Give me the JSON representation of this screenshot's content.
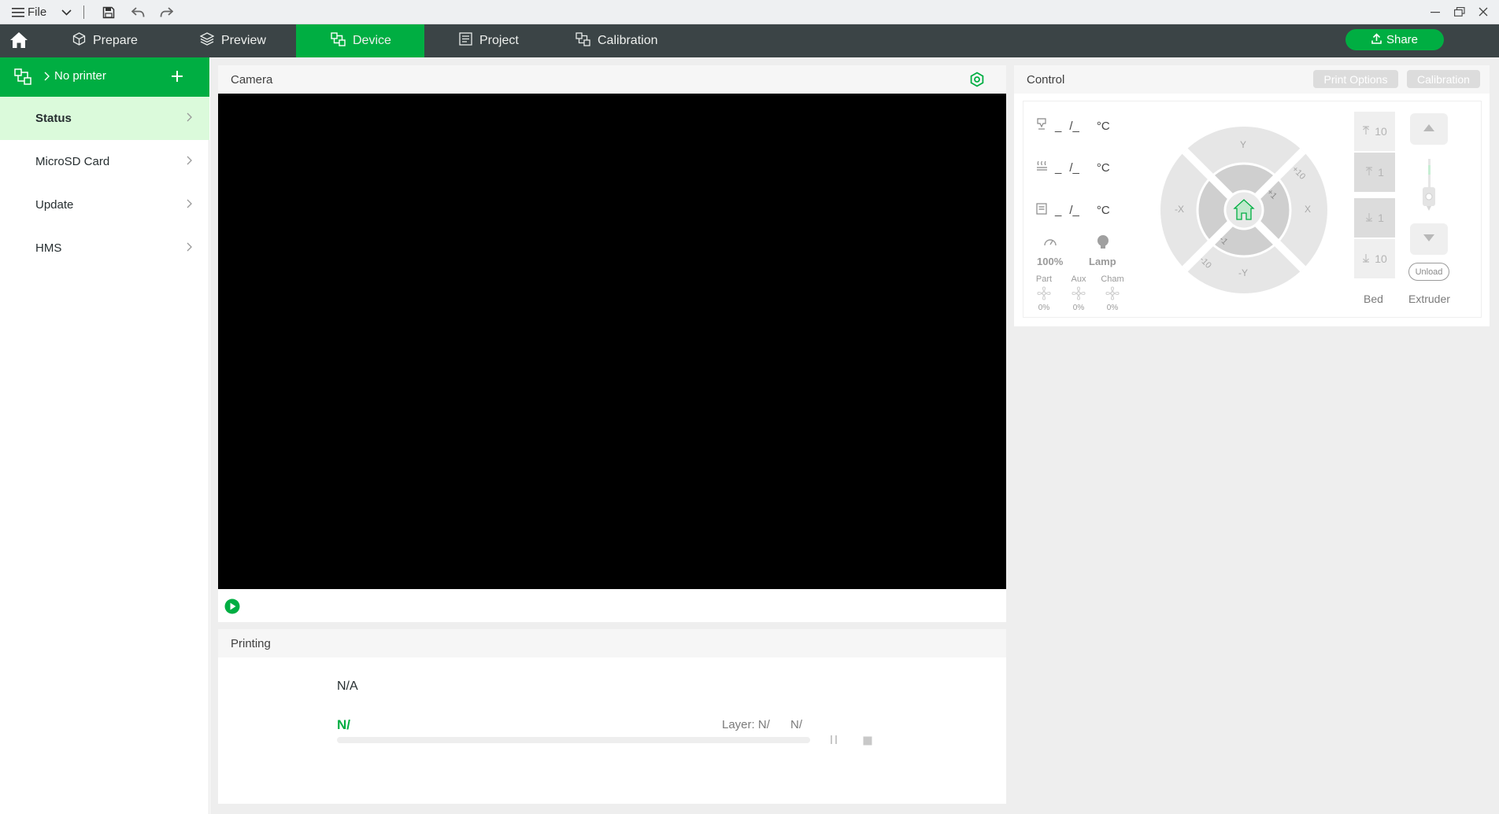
{
  "titlebar": {
    "file_label": "File",
    "icons": [
      "menu-icon",
      "chevron-down-icon",
      "save-icon",
      "undo-icon",
      "redo-icon",
      "minimize-icon",
      "restore-icon",
      "close-icon"
    ]
  },
  "nav": {
    "tabs": [
      {
        "label": "Prepare",
        "icon": "cube-icon"
      },
      {
        "label": "Preview",
        "icon": "layers-icon"
      },
      {
        "label": "Device",
        "icon": "device-icon",
        "active": true
      },
      {
        "label": "Project",
        "icon": "project-icon"
      },
      {
        "label": "Calibration",
        "icon": "calibration-icon"
      }
    ],
    "share_label": "Share"
  },
  "sidebar": {
    "printer_label": "No printer",
    "items": [
      {
        "label": "Status",
        "active": true
      },
      {
        "label": "MicroSD Card"
      },
      {
        "label": "Update"
      },
      {
        "label": "HMS"
      }
    ]
  },
  "camera": {
    "title": "Camera"
  },
  "printing": {
    "title": "Printing",
    "task_name": "N/A",
    "progress_text": "N/",
    "layer_label": "Layer: N/",
    "layer_total": "N/",
    "progress": 0
  },
  "control": {
    "title": "Control",
    "print_options_label": "Print Options",
    "calibration_label": "Calibration",
    "temps": [
      {
        "icon": "nozzle-icon",
        "value": "_",
        "sep": "/_",
        "unit": "°C"
      },
      {
        "icon": "bed-heat-icon",
        "value": "_",
        "sep": "/_",
        "unit": "°C"
      },
      {
        "icon": "chamber-icon",
        "value": "_",
        "sep": "/_",
        "unit": "°C"
      }
    ],
    "speed_value": "100%",
    "lamp_label": "Lamp",
    "fans": [
      {
        "label": "Part",
        "value": "0%"
      },
      {
        "label": "Aux",
        "value": "0%"
      },
      {
        "label": "Cham",
        "value": "0%"
      }
    ],
    "jog": {
      "y_plus": "Y",
      "y_minus": "-Y",
      "x_plus": "X",
      "x_minus": "-X",
      "plus10": "+10",
      "plus1": "+1",
      "minus1": "-1",
      "minus10": "-10"
    },
    "bed_steps": [
      "10",
      "1",
      "1",
      "10"
    ],
    "bed_label": "Bed",
    "extruder_label": "Extruder",
    "unload_label": "Unload"
  },
  "colors": {
    "accent": "#00ae42",
    "nav_bg": "#3b4446",
    "sidebar_active_bg": "#dbfadb"
  }
}
